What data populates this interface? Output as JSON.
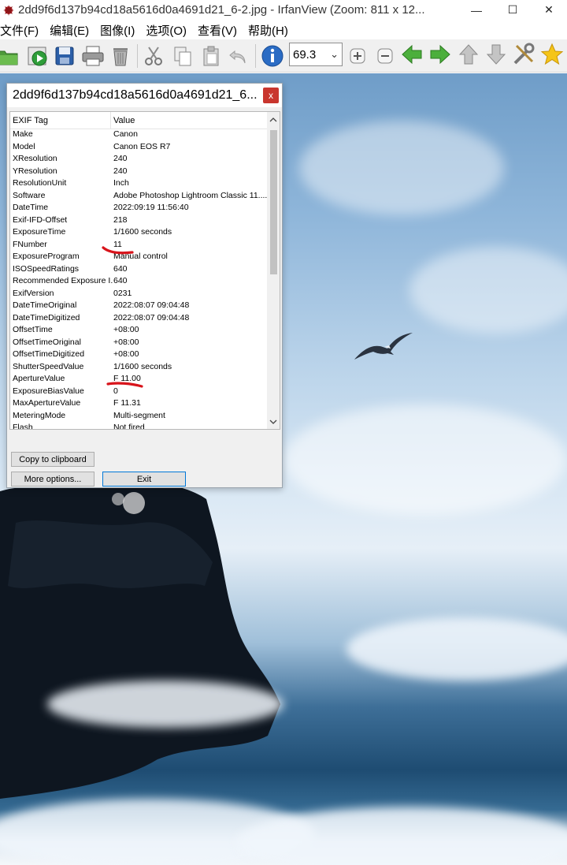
{
  "window": {
    "title": "2dd9f6d137b94cd18a5616d0a4691d21_6-2.jpg - IrfanView (Zoom: 811 x 12...",
    "minimize": "—",
    "maximize": "☐",
    "close": "✕"
  },
  "menu": [
    {
      "label": "文件(F)"
    },
    {
      "label": "编辑(E)"
    },
    {
      "label": "图像(I)"
    },
    {
      "label": "选项(O)"
    },
    {
      "label": "查看(V)"
    },
    {
      "label": "帮助(H)"
    }
  ],
  "toolbar": {
    "zoom_value": "69.3",
    "zoom_arrow": "⌄"
  },
  "dialog": {
    "title": "2dd9f6d137b94cd18a5616d0a4691d21_6...",
    "close": "x",
    "columns": {
      "tag": "EXIF Tag",
      "value": "Value"
    },
    "rows": [
      {
        "tag": "Make",
        "value": "Canon"
      },
      {
        "tag": "Model",
        "value": "Canon EOS R7"
      },
      {
        "tag": "XResolution",
        "value": "240"
      },
      {
        "tag": "YResolution",
        "value": "240"
      },
      {
        "tag": "ResolutionUnit",
        "value": "Inch"
      },
      {
        "tag": "Software",
        "value": "Adobe Photoshop Lightroom Classic 11...."
      },
      {
        "tag": "DateTime",
        "value": "2022:09:19 11:56:40"
      },
      {
        "tag": "Exif-IFD-Offset",
        "value": "218"
      },
      {
        "tag": "ExposureTime",
        "value": "1/1600 seconds"
      },
      {
        "tag": "FNumber",
        "value": "11"
      },
      {
        "tag": "ExposureProgram",
        "value": "Manual control"
      },
      {
        "tag": "ISOSpeedRatings",
        "value": "640"
      },
      {
        "tag": "Recommended Exposure I...",
        "value": "640"
      },
      {
        "tag": "ExifVersion",
        "value": "0231"
      },
      {
        "tag": "DateTimeOriginal",
        "value": "2022:08:07 09:04:48"
      },
      {
        "tag": "DateTimeDigitized",
        "value": "2022:08:07 09:04:48"
      },
      {
        "tag": "OffsetTime",
        "value": "+08:00"
      },
      {
        "tag": "OffsetTimeOriginal",
        "value": "+08:00"
      },
      {
        "tag": "OffsetTimeDigitized",
        "value": "+08:00"
      },
      {
        "tag": "ShutterSpeedValue",
        "value": "1/1600 seconds"
      },
      {
        "tag": "ApertureValue",
        "value": "F 11.00"
      },
      {
        "tag": "ExposureBiasValue",
        "value": "0"
      },
      {
        "tag": "MaxApertureValue",
        "value": "F 11.31"
      },
      {
        "tag": "MeteringMode",
        "value": "Multi-segment"
      },
      {
        "tag": "Flash",
        "value": "Not fired"
      }
    ],
    "copy_button": "Copy to clipboard",
    "more_button": "More options...",
    "exit_button": "Exit"
  },
  "colors": {
    "annotation_red": "#d8141b",
    "dialog_close": "#c9362e",
    "default_button_border": "#0078d7"
  }
}
